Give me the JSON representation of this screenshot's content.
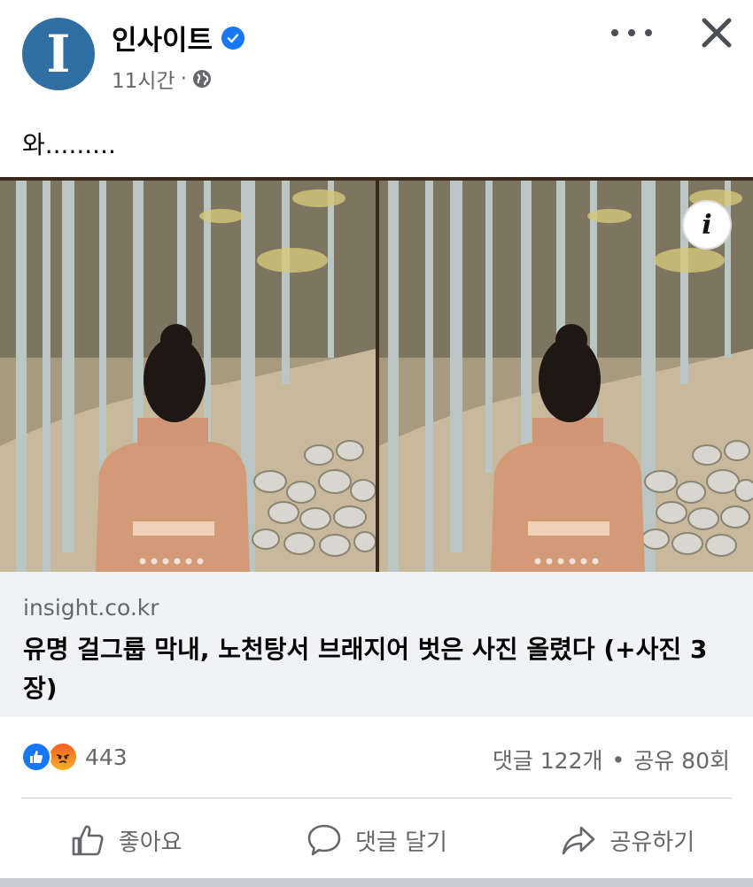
{
  "post": {
    "page_name": "인사이트",
    "avatar_letter": "I",
    "time": "11시간",
    "separator": "·",
    "text": "와........."
  },
  "icons": {
    "verified": "verified-badge-icon",
    "privacy": "globe-icon",
    "more": "more-options-icon",
    "close": "close-icon",
    "info": "info-icon"
  },
  "link": {
    "domain": "insight.co.kr",
    "title": "유명 걸그룹 막내, 노천탕서 브래지어 벗은 사진 올렸다 (+사진 3장)"
  },
  "engagement": {
    "reaction_count": "443",
    "comments": "댓글 122개",
    "dot": "•",
    "shares": "공유 80회"
  },
  "actions": {
    "like": "좋아요",
    "comment": "댓글 달기",
    "share": "공유하기"
  },
  "info_label": "i",
  "colors": {
    "brand_blue": "#1877f2",
    "avatar_blue": "#2f6fa3",
    "secondary_text": "#65676b",
    "link_bg": "#f0f2f5"
  }
}
